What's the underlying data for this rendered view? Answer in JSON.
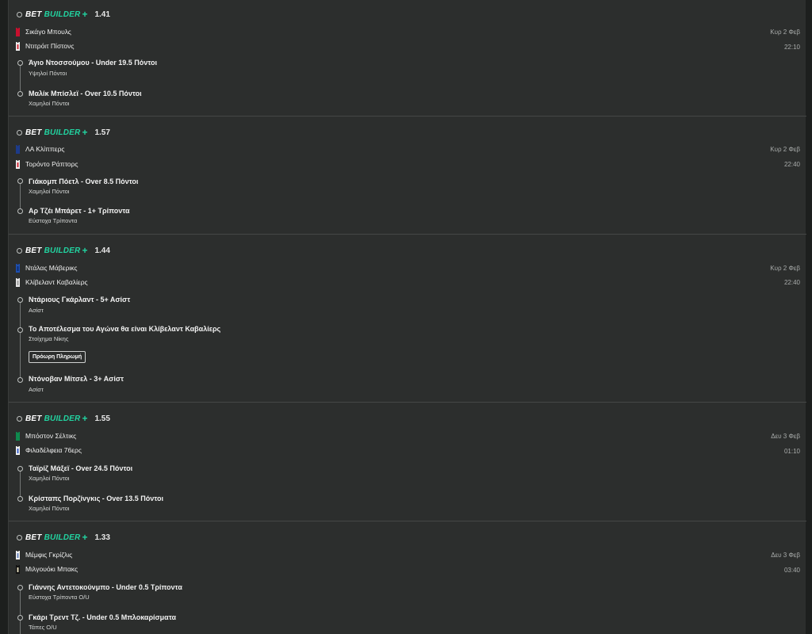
{
  "colors": {
    "accent": "#22d3a0",
    "panel": "#2c2e2d"
  },
  "brand": {
    "bet": "BET",
    "builder": "BUILDER",
    "plus": "+"
  },
  "cards": [
    {
      "odds": "1.41",
      "home": {
        "name": "Σικάγο Μπουλς",
        "kit": "red"
      },
      "away": {
        "name": "Ντιτρόιτ Πίστονς",
        "kit": "white-red"
      },
      "date": "Κυρ 2 Φεβ",
      "time": "22:10",
      "selections": [
        {
          "title": "Άγιο Ντοσσούμου - Under 19.5 Πόντοι",
          "sub": "Υψηλοί Πόντοι"
        },
        {
          "title": "Μαλίκ Μπίσλεϊ - Over 10.5 Πόντοι",
          "sub": "Χαμηλοί Πόντοι"
        }
      ]
    },
    {
      "odds": "1.57",
      "home": {
        "name": "ΛΑ Κλίππερς",
        "kit": "navy"
      },
      "away": {
        "name": "Τορόντο Ράπτορς",
        "kit": "white-red"
      },
      "date": "Κυρ 2 Φεβ",
      "time": "22:40",
      "selections": [
        {
          "title": "Γιάκομπ Πόετλ - Over 8.5 Πόντοι",
          "sub": "Χαμηλοί Πόντοι"
        },
        {
          "title": "Αρ Τζέι Μπάρετ - 1+ Τρίποντα",
          "sub": "Εύστοχα Τρίποντα"
        }
      ]
    },
    {
      "odds": "1.44",
      "home": {
        "name": "Ντάλας Μάβερικς",
        "kit": "blue"
      },
      "away": {
        "name": "Κλίβελαντ Καβαλίερς",
        "kit": "white-grey"
      },
      "date": "Κυρ 2 Φεβ",
      "time": "22:40",
      "early_payout": "Πρόωρη Πληρωμή",
      "selections": [
        {
          "title": "Ντάριους Γκάρλαντ - 5+ Ασίστ",
          "sub": "Ασίστ"
        },
        {
          "title": "Το Αποτέλεσμα του Αγώνα θα είναι Κλίβελαντ Καβαλίερς",
          "sub": "Στοίχημα Νίκης"
        },
        {
          "title": "Ντόνοβαν Μίτσελ - 3+ Ασίστ",
          "sub": "Ασίστ"
        }
      ]
    },
    {
      "odds": "1.55",
      "home": {
        "name": "Μπόστον Σέλτικς",
        "kit": "green"
      },
      "away": {
        "name": "Φιλαδέλφεια 76ερς",
        "kit": "white-blue"
      },
      "date": "Δευ 3 Φεβ",
      "time": "01:10",
      "selections": [
        {
          "title": "Ταϊρίζ Μάξεϊ - Over 24.5 Πόντοι",
          "sub": "Χαμηλοί Πόντοι"
        },
        {
          "title": "Κρίσταπς Πορζίνγκις - Over 13.5 Πόντοι",
          "sub": "Χαμηλοί Πόντοι"
        }
      ]
    },
    {
      "odds": "1.33",
      "home": {
        "name": "Μέμφις Γκρίζλις",
        "kit": "white-navy"
      },
      "away": {
        "name": "Μιλγουόκι Μπακς",
        "kit": "black-green"
      },
      "date": "Δευ 3 Φεβ",
      "time": "03:40",
      "selections": [
        {
          "title": "Γιάννης Αντετοκούνμπο - Under 0.5 Τρίποντα",
          "sub": "Εύστοχα Τρίποντα O/U"
        },
        {
          "title": "Γκάρι Τρεντ Τζ. - Under 0.5 Μπλοκαρίσματα",
          "sub": "Τάπες O/U"
        }
      ]
    }
  ]
}
